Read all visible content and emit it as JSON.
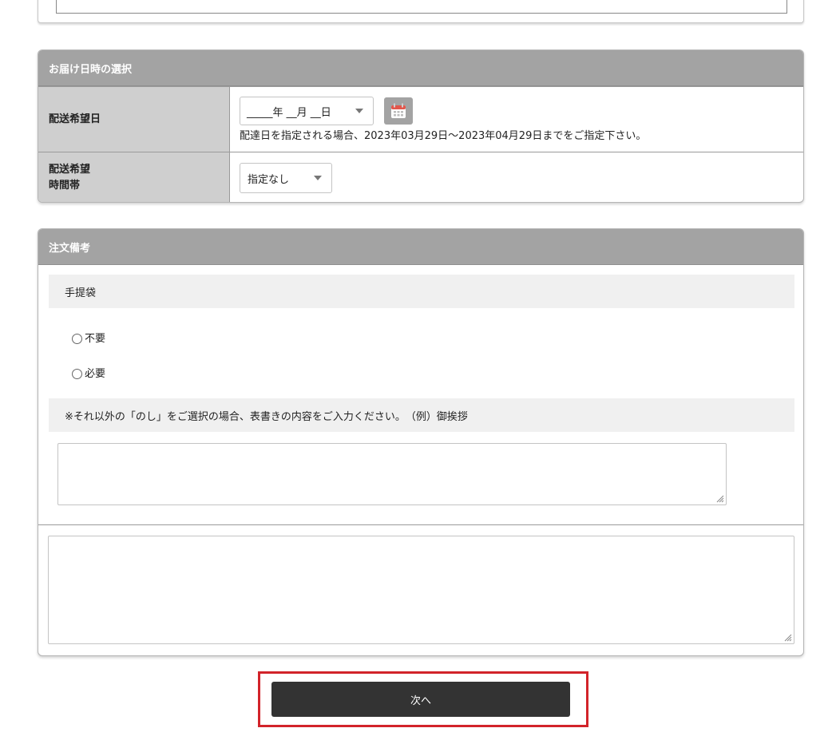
{
  "delivery": {
    "header": "お届け日時の選択",
    "date_label": "配送希望日",
    "date_select_value": "_____年 __月 __日",
    "date_hint": "配達日を指定される場合、2023年03月29日〜2023年04月29日までをご指定下さい。",
    "time_label_line1": "配送希望",
    "time_label_line2": "時間帯",
    "time_select_value": "指定なし"
  },
  "notes": {
    "header": "注文備考",
    "bag_title": "手提袋",
    "options": [
      "不要",
      "必要"
    ],
    "noshi_instruction": "※それ以外の「のし」をご選択の場合、表書きの内容をご入力ください。　（例）御挨拶",
    "noshi_text_value": "",
    "remarks_value": ""
  },
  "actions": {
    "next_label": "次へ"
  },
  "colors": {
    "header_bg": "#a3a3a3",
    "label_bg": "#cfcfcf",
    "button_bg": "#333333",
    "highlight": "#d2232a"
  },
  "icons": {
    "calendar": "calendar-icon",
    "dropdown": "chevron-down-icon",
    "resize": "resize-grip-icon"
  }
}
